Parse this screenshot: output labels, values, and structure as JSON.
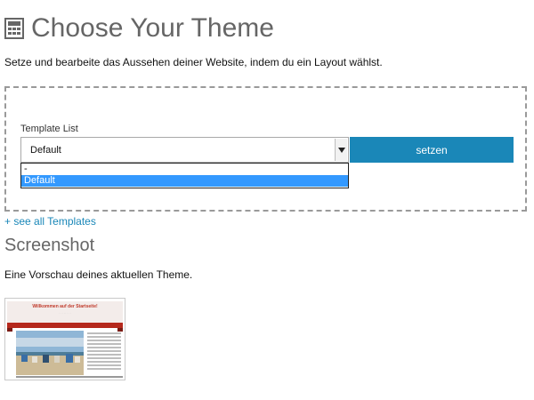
{
  "header": {
    "title": "Choose Your Theme",
    "icon": "layout-icon",
    "description": "Setze und bearbeite das Aussehen deiner Website, indem du ein Layout wählst."
  },
  "template_form": {
    "label": "Template List",
    "selected_value": "Default",
    "submit_label": "setzen",
    "options": [
      "-",
      "Default"
    ],
    "highlighted_option": "Default",
    "accent_color": "#1a87b8",
    "highlight_color": "#3399ff"
  },
  "links": {
    "see_all": "+ see all Templates"
  },
  "screenshot_section": {
    "title": "Screenshot",
    "description": "Eine Vorschau deines aktuellen Theme.",
    "preview_title": "Willkommen auf der Startseite!",
    "preview_brand_color": "#b5281c"
  }
}
